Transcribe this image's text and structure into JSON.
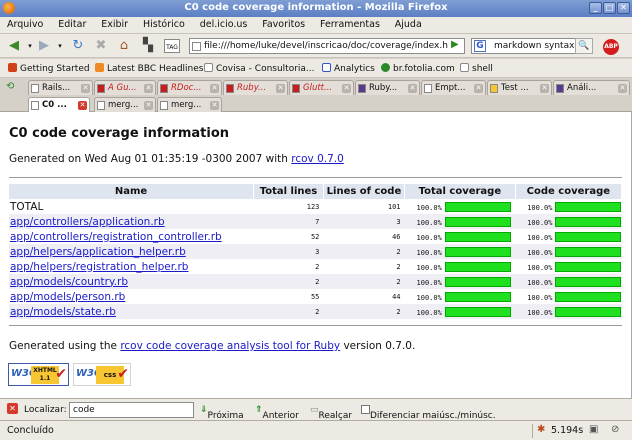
{
  "window": {
    "title": "C0 code coverage information - Mozilla Firefox"
  },
  "menu": [
    "Arquivo",
    "Editar",
    "Exibir",
    "Histórico",
    "del.icio.us",
    "Favoritos",
    "Ferramentas",
    "Ajuda"
  ],
  "nav": {
    "url": "file:///home/luke/devel/inscricao/doc/coverage/index.h",
    "search": "markdown syntax"
  },
  "bookmarks": [
    "Getting Started",
    "Latest BBC Headlines",
    "Covisa - Consultoria...",
    "Analytics",
    "br.fotolia.com",
    "shell"
  ],
  "tabs": {
    "row1": [
      "Rails...",
      "A Gu...",
      "RDoc...",
      "Ruby...",
      "Glutt...",
      "Ruby...",
      "Empt...",
      "Test ...",
      "Análi..."
    ],
    "row2": [
      "C0 ...",
      "merg...",
      "merg..."
    ]
  },
  "page": {
    "title": "C0 code coverage information",
    "generated_prefix": "Generated on Wed Aug 01 01:35:19 -0300 2007 with ",
    "generated_link": "rcov 0.7.0",
    "headers": [
      "Name",
      "Total lines",
      "Lines of code",
      "Total coverage",
      "Code coverage"
    ],
    "rows": [
      {
        "name": "TOTAL",
        "total": "123",
        "loc": "101",
        "tc": "100.0%",
        "cc": "100.0%",
        "link": false
      },
      {
        "name": "app/controllers/application.rb",
        "total": "7",
        "loc": "3",
        "tc": "100.0%",
        "cc": "100.0%",
        "link": true
      },
      {
        "name": "app/controllers/registration_controller.rb",
        "total": "52",
        "loc": "46",
        "tc": "100.0%",
        "cc": "100.0%",
        "link": true
      },
      {
        "name": "app/helpers/application_helper.rb",
        "total": "3",
        "loc": "2",
        "tc": "100.0%",
        "cc": "100.0%",
        "link": true
      },
      {
        "name": "app/helpers/registration_helper.rb",
        "total": "2",
        "loc": "2",
        "tc": "100.0%",
        "cc": "100.0%",
        "link": true
      },
      {
        "name": "app/models/country.rb",
        "total": "2",
        "loc": "2",
        "tc": "100.0%",
        "cc": "100.0%",
        "link": true
      },
      {
        "name": "app/models/person.rb",
        "total": "55",
        "loc": "44",
        "tc": "100.0%",
        "cc": "100.0%",
        "link": true
      },
      {
        "name": "app/models/state.rb",
        "total": "2",
        "loc": "2",
        "tc": "100.0%",
        "cc": "100.0%",
        "link": true
      }
    ],
    "footer_prefix": "Generated using the ",
    "footer_link": "rcov code coverage analysis tool for Ruby",
    "footer_suffix": " version 0.7.0.",
    "badge_xhtml": "XHTML 1.1",
    "badge_css": "css"
  },
  "findbar": {
    "label": "Localizar:",
    "value": "code",
    "next": "Próxima",
    "prev": "Anterior",
    "highlight": "Realçar",
    "match_case": "Diferenciar maiúsc./minúsc."
  },
  "status": {
    "text": "Concluído",
    "time": "5.194s"
  }
}
